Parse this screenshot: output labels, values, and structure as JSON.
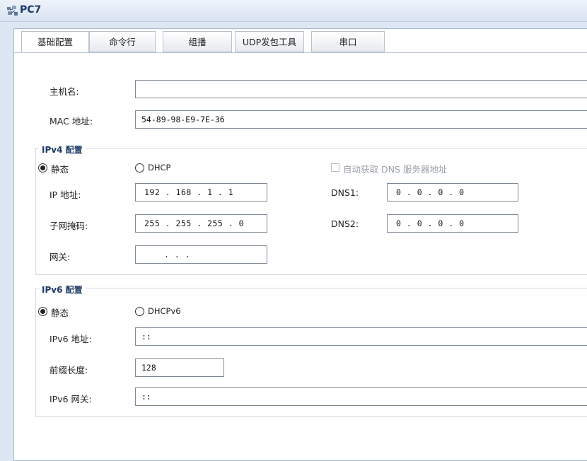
{
  "window": {
    "title": "PC7"
  },
  "tabs": [
    "基础配置",
    "命令行",
    "组播",
    "UDP发包工具",
    "串口"
  ],
  "basic": {
    "hostname_label": "主机名:",
    "hostname_value": "",
    "mac_label": "MAC 地址:",
    "mac_value": "54-89-98-E9-7E-36"
  },
  "ipv4": {
    "group_title": "IPv4 配置",
    "static_label": "静态",
    "dhcp_label": "DHCP",
    "auto_dns_label": "自动获取 DNS 服务器地址",
    "ip_label": "IP 地址:",
    "ip_value": "192 . 168 .  1  .  1",
    "mask_label": "子网掩码:",
    "mask_value": "255 . 255 . 255 .  0",
    "gateway_label": "网关:",
    "gateway_value": " .    .    .",
    "dns1_label": "DNS1:",
    "dns1_value": "0  .  0  .  0  .  0",
    "dns2_label": "DNS2:",
    "dns2_value": "0  .  0  .  0  .  0"
  },
  "ipv6": {
    "group_title": "IPv6 配置",
    "static_label": "静态",
    "dhcp_label": "DHCPv6",
    "ip_label": "IPv6 地址:",
    "ip_value": "::",
    "prefix_label": "前缀长度:",
    "prefix_value": "128",
    "gateway_label": "IPv6 网关:",
    "gateway_value": "::"
  }
}
